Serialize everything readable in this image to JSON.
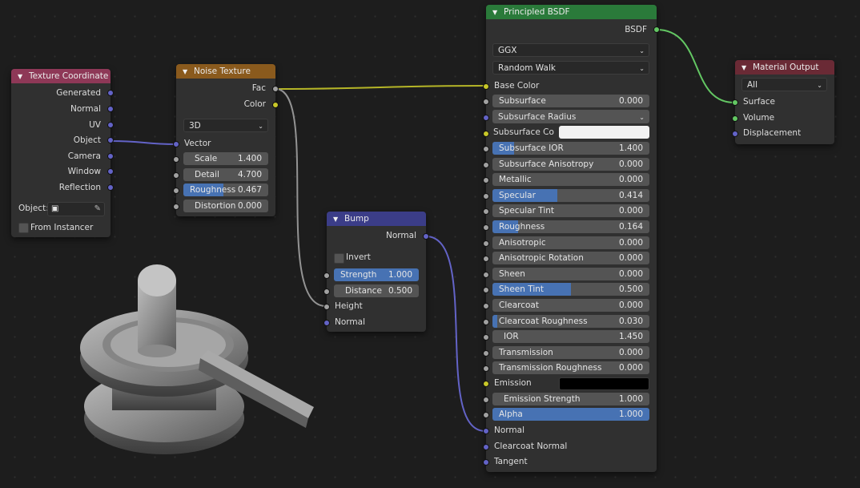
{
  "texture_coordinate": {
    "title": "Texture Coordinate",
    "outputs": [
      "Generated",
      "Normal",
      "UV",
      "Object",
      "Camera",
      "Window",
      "Reflection"
    ],
    "object_label": "Object:",
    "from_instancer_label": "From Instancer"
  },
  "noise_texture": {
    "title": "Noise Texture",
    "outputs": [
      "Fac",
      "Color"
    ],
    "dimension": "3D",
    "vector_label": "Vector",
    "fields": [
      {
        "label": "Scale",
        "value": "1.400"
      },
      {
        "label": "Detail",
        "value": "4.700"
      },
      {
        "label": "Roughness",
        "value": "0.467",
        "fraction": 0.467
      },
      {
        "label": "Distortion",
        "value": "0.000"
      }
    ]
  },
  "bump": {
    "title": "Bump",
    "output": "Normal",
    "invert_label": "Invert",
    "fields": [
      {
        "label": "Strength",
        "value": "1.000",
        "fraction": 1.0
      },
      {
        "label": "Distance",
        "value": "0.500"
      }
    ],
    "inputs": [
      "Height",
      "Normal"
    ]
  },
  "principled": {
    "title": "Principled BSDF",
    "output": "BSDF",
    "distribution": "GGX",
    "subsurface_method": "Random Walk",
    "base_color_label": "Base Color",
    "subsurface": {
      "label": "Subsurface",
      "value": "0.000"
    },
    "subsurface_radius": "Subsurface Radius",
    "subsurface_color_label": "Subsurface Co",
    "subsurface_color": "#f2f2f2",
    "sliders": [
      {
        "label": "Subsurface IOR",
        "value": "1.400",
        "fraction": 0.14
      },
      {
        "label": "Subsurface Anisotropy",
        "value": "0.000",
        "fraction": 0
      },
      {
        "label": "Metallic",
        "value": "0.000",
        "fraction": 0
      },
      {
        "label": "Specular",
        "value": "0.414",
        "fraction": 0.414
      },
      {
        "label": "Specular Tint",
        "value": "0.000",
        "fraction": 0
      },
      {
        "label": "Roughness",
        "value": "0.164",
        "fraction": 0.164
      },
      {
        "label": "Anisotropic",
        "value": "0.000",
        "fraction": 0
      },
      {
        "label": "Anisotropic Rotation",
        "value": "0.000",
        "fraction": 0
      },
      {
        "label": "Sheen",
        "value": "0.000",
        "fraction": 0
      },
      {
        "label": "Sheen Tint",
        "value": "0.500",
        "fraction": 0.5
      },
      {
        "label": "Clearcoat",
        "value": "0.000",
        "fraction": 0
      },
      {
        "label": "Clearcoat Roughness",
        "value": "0.030",
        "fraction": 0.03
      },
      {
        "label": "IOR",
        "value": "1.450",
        "fraction": 0
      },
      {
        "label": "Transmission",
        "value": "0.000",
        "fraction": 0
      },
      {
        "label": "Transmission Roughness",
        "value": "0.000",
        "fraction": 0
      }
    ],
    "emission_label": "Emission",
    "emission_color": "#000000",
    "emission_strength": {
      "label": "Emission Strength",
      "value": "1.000"
    },
    "alpha": {
      "label": "Alpha",
      "value": "1.000",
      "fraction": 1.0
    },
    "bottom_inputs": [
      "Normal",
      "Clearcoat Normal",
      "Tangent"
    ]
  },
  "material_output": {
    "title": "Material Output",
    "target": "All",
    "inputs": [
      "Surface",
      "Volume",
      "Displacement"
    ]
  },
  "colors": {
    "header_texture": "#8e3857",
    "header_noise": "#8a5a1d",
    "header_bump": "#3b3d88",
    "header_shader": "#2a7a3a",
    "header_output": "#6a2a35",
    "slider_fill": "#4772b3",
    "link_color": "#c7c729",
    "link_float": "#a1a1a1",
    "link_vector": "#6363c7",
    "link_shader": "#63c763"
  }
}
